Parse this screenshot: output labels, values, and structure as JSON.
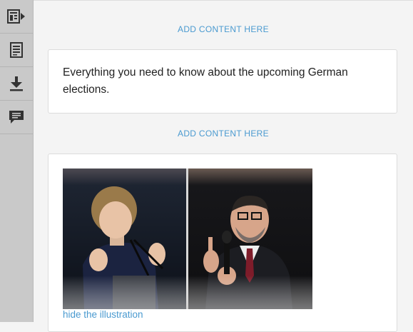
{
  "sidebar": {
    "tools": [
      {
        "icon": "insert-block-icon"
      },
      {
        "icon": "document-icon"
      },
      {
        "icon": "download-icon"
      },
      {
        "icon": "comment-icon"
      }
    ]
  },
  "main": {
    "add_content_label": "ADD CONTENT HERE",
    "text_block": "Everything you need to know about the upcoming German elections.",
    "image_block": {
      "toggle_label": "hide the illustration"
    }
  },
  "colors": {
    "accent": "#4a9ad0",
    "sidebar": "#c9c9c9",
    "icon": "#333333"
  }
}
